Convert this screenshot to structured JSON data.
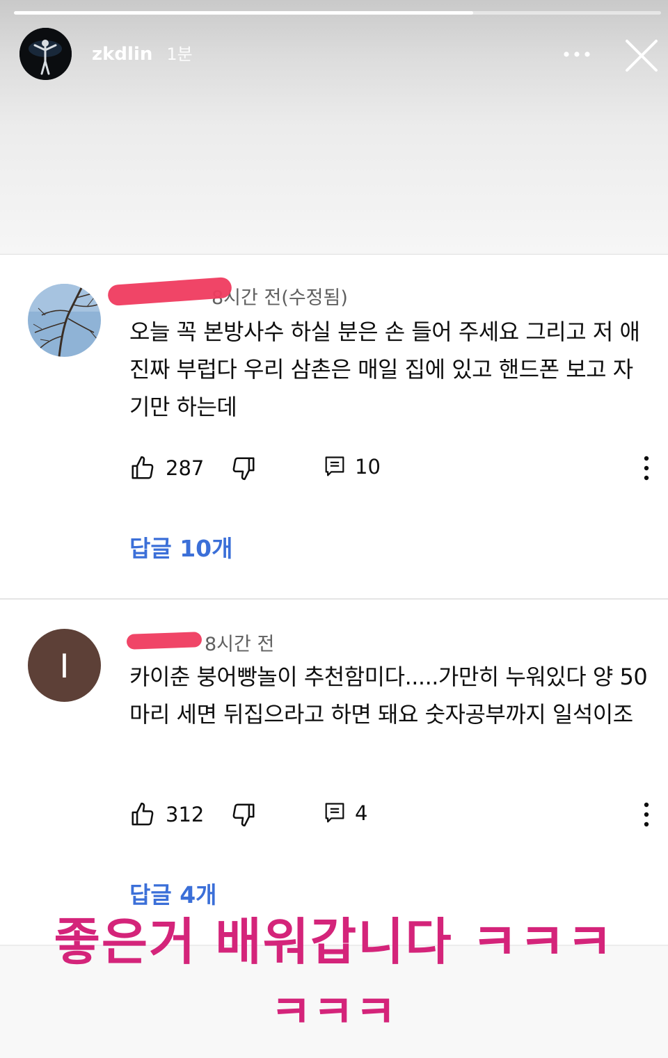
{
  "story": {
    "username": "zkdlin",
    "time": "1분",
    "progress": 0.71
  },
  "comments": [
    {
      "time": "8시간 전(수정됨)",
      "text": "오늘 꼭 본방사수 하실 분은 손 들어 주세요 그리고 저 애 진짜 부럽다 우리 삼촌은 매일 집에 있고 핸드폰 보고 자기만 하는데",
      "likes": "287",
      "reply_count": "10",
      "replies_label": "답글 10개"
    },
    {
      "avatar_letter": "I",
      "time": "8시간 전",
      "text": "카이춘 붕어빵놀이 추천함미다.....가만히 누워있다 양 50마리 세면 뒤집으라고 하면 돼요 숫자공부까지 일석이조",
      "likes": "312",
      "reply_count": "4",
      "replies_label": "답글 4개"
    }
  ],
  "overlay": {
    "line1": "좋은거 배워갑니다 ㅋㅋㅋ",
    "line2": "ㅋㅋㅋ"
  },
  "colors": {
    "overlay_text": "#d4247a",
    "replies_link": "#3b6fd8",
    "redaction": "#ef3b5f"
  }
}
